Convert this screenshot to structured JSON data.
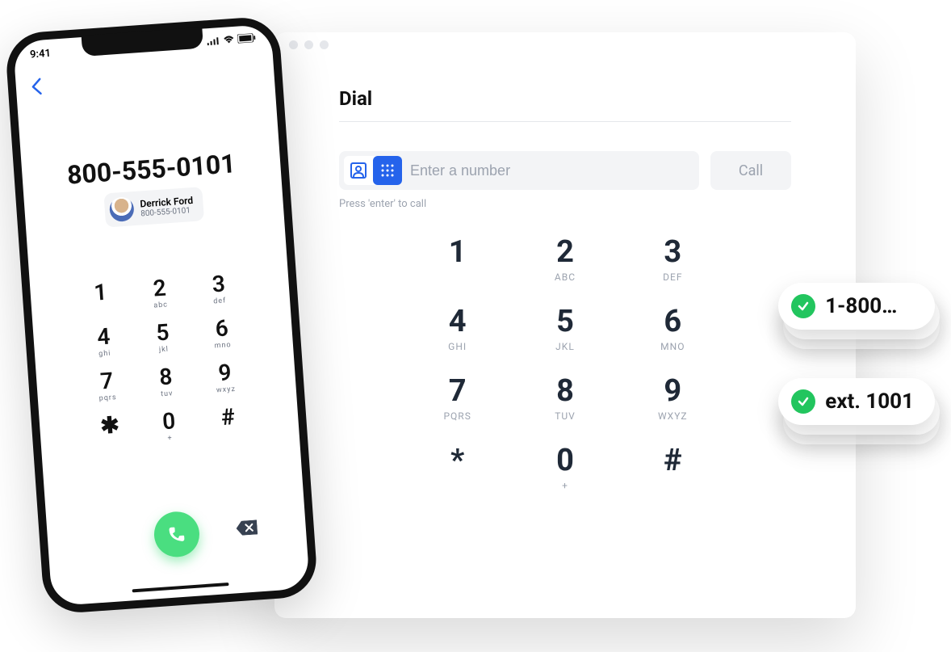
{
  "phone": {
    "status_time": "9:41",
    "dialed_number": "800-555-0101",
    "contact": {
      "name": "Derrick Ford",
      "number": "800-555-0101"
    },
    "keys": [
      {
        "digit": "1",
        "letters": ""
      },
      {
        "digit": "2",
        "letters": "abc"
      },
      {
        "digit": "3",
        "letters": "def"
      },
      {
        "digit": "4",
        "letters": "ghi"
      },
      {
        "digit": "5",
        "letters": "jkl"
      },
      {
        "digit": "6",
        "letters": "mno"
      },
      {
        "digit": "7",
        "letters": "pqrs"
      },
      {
        "digit": "8",
        "letters": "tuv"
      },
      {
        "digit": "9",
        "letters": "wxyz"
      },
      {
        "digit": "✱",
        "letters": ""
      },
      {
        "digit": "0",
        "letters": "+"
      },
      {
        "digit": "#",
        "letters": ""
      }
    ]
  },
  "window": {
    "title": "Dial",
    "placeholder": "Enter a number",
    "call_label": "Call",
    "helper": "Press 'enter' to call",
    "keys": [
      {
        "digit": "1",
        "letters": ""
      },
      {
        "digit": "2",
        "letters": "ABC"
      },
      {
        "digit": "3",
        "letters": "DEF"
      },
      {
        "digit": "4",
        "letters": "GHI"
      },
      {
        "digit": "5",
        "letters": "JKL"
      },
      {
        "digit": "6",
        "letters": "MNO"
      },
      {
        "digit": "7",
        "letters": "PQRS"
      },
      {
        "digit": "8",
        "letters": "TUV"
      },
      {
        "digit": "9",
        "letters": "WXYZ"
      },
      {
        "digit": "*",
        "letters": ""
      },
      {
        "digit": "0",
        "letters": "+"
      },
      {
        "digit": "#",
        "letters": ""
      }
    ]
  },
  "badges": {
    "number": "1-800…",
    "extension": "ext. 1001"
  },
  "colors": {
    "accent_blue": "#2563eb",
    "accent_green": "#22c55e",
    "call_green": "#4ade80"
  }
}
